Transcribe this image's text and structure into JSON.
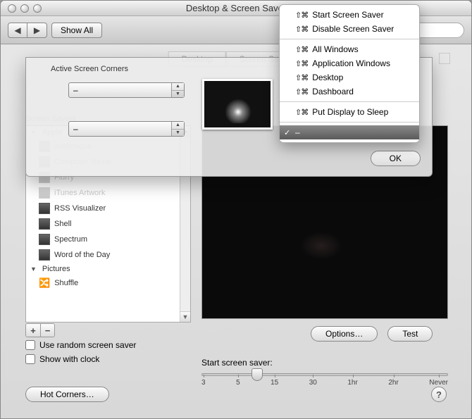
{
  "window": {
    "title": "Desktop & Screen Saver"
  },
  "toolbar": {
    "show_all": "Show All"
  },
  "tabs": {
    "desktop": "Desktop",
    "screensaver": "Screen Saver"
  },
  "sidebar": {
    "header": "Screen Savers",
    "group_apple": "Apple",
    "items_dimmed": [
      "Arabesque",
      "Computer Name",
      "Flurry",
      "iTunes Artwork"
    ],
    "items": [
      "RSS Visualizer",
      "Shell",
      "Spectrum",
      "Word of the Day"
    ],
    "group_pictures": "Pictures",
    "shuffle": "Shuffle"
  },
  "buttons": {
    "options": "Options…",
    "test": "Test",
    "hot_corners": "Hot Corners…",
    "ok": "OK"
  },
  "checkboxes": {
    "random": "Use random screen saver",
    "clock": "Show with clock"
  },
  "slider": {
    "label": "Start screen saver:",
    "ticks": [
      "3",
      "5",
      "15",
      "30",
      "1hr",
      "2hr",
      "Never"
    ]
  },
  "sheet": {
    "title": "Active Screen Corners",
    "dash_top_left": "–",
    "dash_bottom_left": "–"
  },
  "menu": {
    "items_group1": [
      "Start Screen Saver",
      "Disable Screen Saver"
    ],
    "items_group2": [
      "All Windows",
      "Application Windows",
      "Desktop",
      "Dashboard"
    ],
    "items_group3": [
      "Put Display to Sleep"
    ],
    "checked": "–",
    "modifier": "⇧⌘"
  }
}
